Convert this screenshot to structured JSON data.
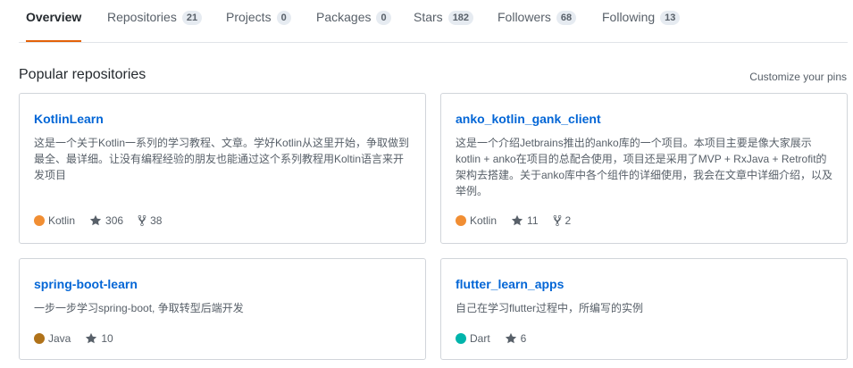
{
  "tabs": [
    {
      "label": "Overview",
      "count": null
    },
    {
      "label": "Repositories",
      "count": "21"
    },
    {
      "label": "Projects",
      "count": "0"
    },
    {
      "label": "Packages",
      "count": "0"
    },
    {
      "label": "Stars",
      "count": "182"
    },
    {
      "label": "Followers",
      "count": "68"
    },
    {
      "label": "Following",
      "count": "13"
    }
  ],
  "section": {
    "title": "Popular repositories",
    "customize_label": "Customize your pins"
  },
  "repos": [
    {
      "name": "KotlinLearn",
      "description": "这是一个关于Kotlin一系列的学习教程、文章。学好Kotlin从这里开始，争取做到最全、最详细。让没有编程经验的朋友也能通过这个系列教程用Koltin语言来开发项目",
      "language": "Kotlin",
      "language_color": "#F18E33",
      "stars": "306",
      "forks": "38"
    },
    {
      "name": "anko_kotlin_gank_client",
      "description": "这是一个介绍Jetbrains推出的anko库的一个项目。本项目主要是像大家展示kotlin + anko在项目的总配合使用，项目还是采用了MVP + RxJava + Retrofit的架构去搭建。关于anko库中各个组件的详细使用，我会在文章中详细介绍，以及举例。",
      "language": "Kotlin",
      "language_color": "#F18E33",
      "stars": "11",
      "forks": "2"
    },
    {
      "name": "spring-boot-learn",
      "description": "一步一步学习spring-boot, 争取转型后端开发",
      "language": "Java",
      "language_color": "#B07219",
      "stars": "10",
      "forks": null
    },
    {
      "name": "flutter_learn_apps",
      "description": "自己在学习flutter过程中，所编写的实例",
      "language": "Dart",
      "language_color": "#00B4AB",
      "stars": "6",
      "forks": null
    }
  ],
  "icons": {
    "star": "star-icon",
    "fork": "fork-icon"
  },
  "colors": {
    "tab_selected_underline": "#E36209",
    "link": "#0366D6"
  }
}
